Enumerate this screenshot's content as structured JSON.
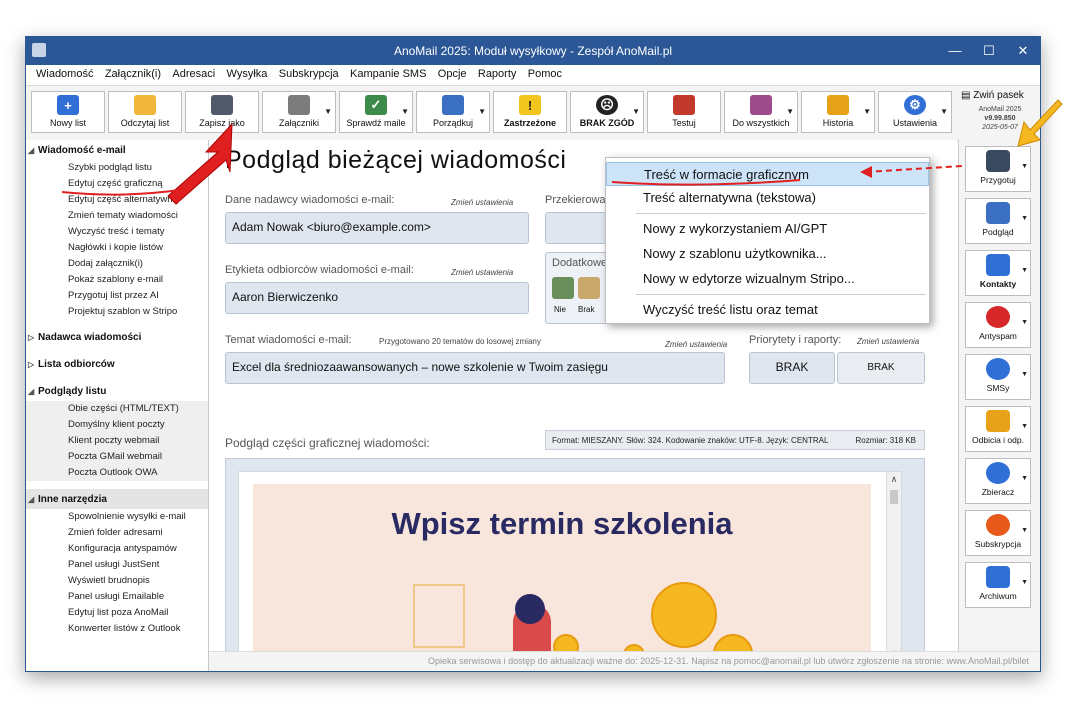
{
  "window": {
    "title": "AnoMail 2025: Moduł wysyłkowy - Zespół AnoMail.pl"
  },
  "menubar": [
    "Wiadomość",
    "Załącznik(i)",
    "Adresaci",
    "Wysyłka",
    "Subskrypcja",
    "Kampanie SMS",
    "Opcje",
    "Raporty",
    "Pomoc"
  ],
  "toolbar": {
    "buttons": [
      {
        "label": "Nowy list",
        "icon": "new-letter-icon",
        "color": "#2f6fd6"
      },
      {
        "label": "Odczytaj list",
        "icon": "folder-icon",
        "color": "#f0b73a"
      },
      {
        "label": "Zapisz jako",
        "icon": "save-icon",
        "color": "#505a68"
      },
      {
        "label": "Załączniki",
        "icon": "attachment-icon",
        "color": "#7c7c7c"
      },
      {
        "label": "Sprawdź maile",
        "icon": "shield-check-icon",
        "color": "#3c8b4a"
      },
      {
        "label": "Porządkuj",
        "icon": "organize-icon",
        "color": "#3b6fc2"
      },
      {
        "label": "Zastrzeżone",
        "icon": "warning-icon",
        "color": "#f2c51c"
      },
      {
        "label": "BRAK ZGÓD",
        "icon": "angry-face-icon",
        "color": "#222222"
      },
      {
        "label": "Testuj",
        "icon": "monitor-icon",
        "color": "#c0392b"
      },
      {
        "label": "Do wszystkich",
        "icon": "mail-all-icon",
        "color": "#9e4b8c"
      },
      {
        "label": "Historia",
        "icon": "history-icon",
        "color": "#e8a21a"
      },
      {
        "label": "Ustawienia",
        "icon": "gear-icon",
        "color": "#2f6fd6"
      }
    ],
    "collapse_label": "Zwiń pasek",
    "version_app": "AnoMail 2025",
    "version": "v9.99.850",
    "version_date": "2025-05-07"
  },
  "sidebar": {
    "sections": [
      {
        "title": "Wiadomość e-mail",
        "items": [
          "Szybki podgląd listu",
          "Edytuj część graficzną",
          "Edytuj część alternatywną",
          "Zmień tematy wiadomości",
          "Wyczyść treść i tematy",
          "Nagłówki i kopie listów",
          "Dodaj załącznik(i)",
          "Pokaż szablony e-mail",
          "Przygotuj list przez AI",
          "Projektuj szablon w Stripo"
        ]
      },
      {
        "title": "Nadawca wiadomości",
        "items": []
      },
      {
        "title": "Lista odbiorców",
        "items": []
      },
      {
        "title": "Podglądy listu",
        "items": [
          "Obie części (HTML/TEXT)",
          "Domyślny klient poczty",
          "Klient poczty webmail",
          "Poczta GMail webmail",
          "Poczta Outlook OWA"
        ]
      },
      {
        "title": "Inne narzędzia",
        "items": [
          "Spowolnienie wysyłki e-mail",
          "Zmień folder adresami",
          "Konfiguracja antyspamów",
          "Panel usługi JustSent",
          "Wyświetl brudnopis",
          "Panel usługi Emailable",
          "Edytuj list poza AnoMail",
          "Konwerter listów z Outlook"
        ]
      }
    ]
  },
  "main": {
    "title": "Podgląd bieżącej wiadomości",
    "sender_label": "Dane nadawcy wiadomości e-mail:",
    "change_settings": "Zmień ustawienia",
    "sender_value": "Adam Nowak <biuro@example.com>",
    "redirect_label": "Przekierowa",
    "recipients_label": "Etykieta odbiorców wiadomości e-mail:",
    "recipients_value": "Aaron Bierwiczenko",
    "extras_label": "Dodatkowe",
    "extras_nie": "Nie",
    "extras_brak": "Brak",
    "subject_label": "Temat wiadomości e-mail:",
    "subject_note": "Przygotowano 20 tematów do losowej zmiany",
    "subject_value": "Excel dla średniozaawansowanych – nowe szkolenie w Twoim zasięgu",
    "priority_label": "Priorytety i raporty:",
    "priority_value": "BRAK",
    "reports_value": "BRAK",
    "preview_label": "Podgląd części graficznej wiadomości:",
    "preview_info": "Format: MIESZANY. Słów: 324. Kodowanie znaków: UTF-8. Język: CENTRAL",
    "preview_size": "Rozmiar: 318 KB",
    "preview_headline": "Wpisz termin szkolenia"
  },
  "dropdown": {
    "items": [
      "Treść w formacie graficznym",
      "Treść alternatywna (tekstowa)",
      "Nowy z wykorzystaniem AI/GPT",
      "Nowy z szablonu użytkownika...",
      "Nowy w edytorze wizualnym Stripo...",
      "Wyczyść treść listu oraz temat"
    ]
  },
  "rightpanel": {
    "buttons": [
      {
        "label": "Przygotuj",
        "icon": "prepare-letter-icon",
        "color": "#3a4a5e"
      },
      {
        "label": "Podgląd",
        "icon": "monitor-icon",
        "color": "#3b6fc2"
      },
      {
        "label": "Kontakty",
        "icon": "contacts-icon",
        "color": "#2f6fd6"
      },
      {
        "label": "Antyspam",
        "icon": "spam-icon",
        "color": "#d62828"
      },
      {
        "label": "SMSy",
        "icon": "sms-icon",
        "color": "#2f6fd6"
      },
      {
        "label": "Odbicia i odp.",
        "icon": "bounce-icon",
        "color": "#e8a21a"
      },
      {
        "label": "Zbieracz",
        "icon": "www-icon",
        "color": "#2f6fd6"
      },
      {
        "label": "Subskrypcja",
        "icon": "bell-icon",
        "color": "#e85a1a"
      },
      {
        "label": "Archiwum",
        "icon": "archive-icon",
        "color": "#2f6fd6"
      }
    ]
  },
  "statusbar": {
    "text": "Opieka serwisowa i dostęp do aktualizacji ważne do: 2025-12-31. Napisz na pomoc@anomail.pl lub utwórz zgłoszenie na stronie: www.AnoMail.pl/bilet"
  }
}
